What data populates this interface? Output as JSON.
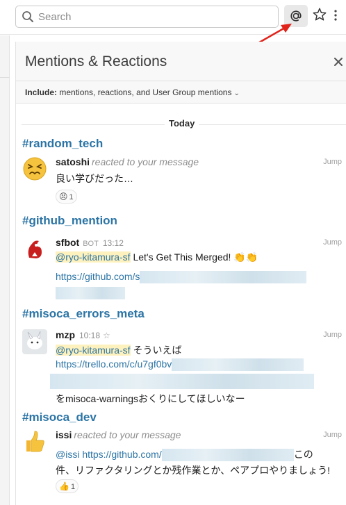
{
  "search": {
    "placeholder": "Search"
  },
  "header": {
    "at_symbol": "@",
    "star": "☆",
    "more": "⋮"
  },
  "panel": {
    "title": "Mentions & Reactions",
    "filter_label": "Include:",
    "filter_value": "mentions, reactions, and User Group mentions",
    "day_label": "Today"
  },
  "groups": [
    {
      "channel": "#random_tech",
      "user": "satoshi",
      "action": "reacted to your message",
      "jump": "Jump",
      "text": "良い学びだった…",
      "reaction_emoji": "😣",
      "reaction_count": "1"
    },
    {
      "channel": "#github_mention",
      "user": "sfbot",
      "bot_tag": "BOT",
      "time": "13:12",
      "jump": "Jump",
      "mention": "@ryo-kitamura-sf",
      "text": "Let's Get This Merged!",
      "text_emoji": "👏👏",
      "link": "https://github.com/s"
    },
    {
      "channel": "#misoca_errors_meta",
      "user": "mzp",
      "time": "10:18",
      "star": "☆",
      "jump": "Jump",
      "mention": "@ryo-kitamura-sf",
      "text": "そういえば",
      "link": "https://trello.com/c/u7gf0bv",
      "last_line": "をmisoca-warningsおくりにしてほしいなー"
    },
    {
      "channel": "#misoca_dev",
      "user": "issi",
      "action": "reacted to your message",
      "jump": "Jump",
      "mention": "@issi",
      "link": "https://github.com/",
      "tail": "この",
      "line2": "件、リファクタリングとか残作業とか、ペアプロやりましょう!",
      "reaction_emoji": "👍",
      "reaction_count": "1"
    }
  ],
  "colors": {
    "link": "#2b74a5",
    "mention_bg": "#fdf1be",
    "arrow": "#e0231b"
  }
}
